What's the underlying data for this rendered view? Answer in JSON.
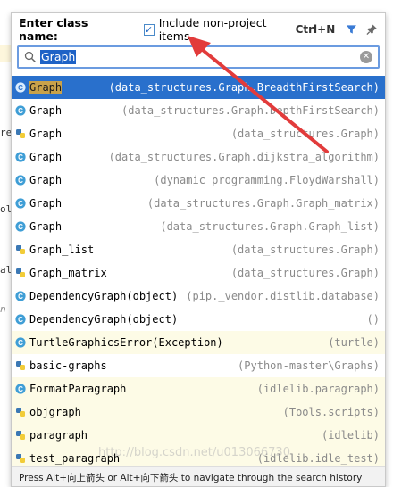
{
  "background_fragments": [
    "re",
    "ol",
    "al",
    "n"
  ],
  "header": {
    "title": "Enter class name:",
    "include_label": "Include non-project items",
    "include_checked": true,
    "shortcut": "Ctrl+N",
    "filter_icon": "funnel-icon",
    "pin_icon": "pin-icon"
  },
  "search": {
    "value": "Graph",
    "search_icon": "magnifier-icon",
    "clear_icon": "clear-icon"
  },
  "results": [
    {
      "prefix": "",
      "hl": "Graph",
      "suffix": "",
      "location": "(data_structures.Graph.BreadthFirstSearch)",
      "icon": "class-icon",
      "selected": true,
      "yellow": false
    },
    {
      "prefix": "Graph",
      "hl": "",
      "suffix": "",
      "location": "(data_structures.Graph.DepthFirstSearch)",
      "icon": "class-icon",
      "selected": false,
      "yellow": false
    },
    {
      "prefix": "Graph",
      "hl": "",
      "suffix": "",
      "location": "(data_structures.Graph)",
      "icon": "python-file-icon",
      "selected": false,
      "yellow": false
    },
    {
      "prefix": "Graph",
      "hl": "",
      "suffix": "",
      "location": "(data_structures.Graph.dijkstra_algorithm)",
      "icon": "class-icon",
      "selected": false,
      "yellow": false
    },
    {
      "prefix": "Graph",
      "hl": "",
      "suffix": "",
      "location": "(dynamic_programming.FloydWarshall)",
      "icon": "class-icon",
      "selected": false,
      "yellow": false
    },
    {
      "prefix": "Graph",
      "hl": "",
      "suffix": "",
      "location": "(data_structures.Graph.Graph_matrix)",
      "icon": "class-icon",
      "selected": false,
      "yellow": false
    },
    {
      "prefix": "Graph",
      "hl": "",
      "suffix": "",
      "location": "(data_structures.Graph.Graph_list)",
      "icon": "class-icon",
      "selected": false,
      "yellow": false
    },
    {
      "prefix": "Graph_list",
      "hl": "",
      "suffix": "",
      "location": "(data_structures.Graph)",
      "icon": "python-file-icon",
      "selected": false,
      "yellow": false
    },
    {
      "prefix": "Graph_matrix",
      "hl": "",
      "suffix": "",
      "location": "(data_structures.Graph)",
      "icon": "python-file-icon",
      "selected": false,
      "yellow": false
    },
    {
      "prefix": "DependencyGraph(object)",
      "hl": "",
      "suffix": "",
      "location": "(pip._vendor.distlib.database)",
      "icon": "class-icon",
      "selected": false,
      "yellow": false
    },
    {
      "prefix": "DependencyGraph(object)",
      "hl": "",
      "suffix": "",
      "location": "()",
      "icon": "class-icon",
      "selected": false,
      "yellow": false
    },
    {
      "prefix": "TurtleGraphicsError(Exception)",
      "hl": "",
      "suffix": "",
      "location": "(turtle)",
      "icon": "class-icon",
      "selected": false,
      "yellow": true
    },
    {
      "prefix": "basic-graphs",
      "hl": "",
      "suffix": "",
      "location": "(Python-master\\Graphs)",
      "icon": "python-file-icon",
      "selected": false,
      "yellow": false
    },
    {
      "prefix": "FormatParagraph",
      "hl": "",
      "suffix": "",
      "location": "(idlelib.paragraph)",
      "icon": "class-icon",
      "selected": false,
      "yellow": true
    },
    {
      "prefix": "objgraph",
      "hl": "",
      "suffix": "",
      "location": "(Tools.scripts)",
      "icon": "python-file-icon",
      "selected": false,
      "yellow": true
    },
    {
      "prefix": "paragraph",
      "hl": "",
      "suffix": "",
      "location": "(idlelib)",
      "icon": "python-file-icon",
      "selected": false,
      "yellow": true
    },
    {
      "prefix": "test_paragraph",
      "hl": "",
      "suffix": "",
      "location": "(idlelib.idle_test)",
      "icon": "python-file-icon",
      "selected": false,
      "yellow": true
    }
  ],
  "footer": {
    "hint": "Press Alt+向上箭头 or Alt+向下箭头 to navigate through the search history"
  },
  "watermark": "http://blog.csdn.net/u013066730",
  "colors": {
    "selection": "#2970cc",
    "highlight": "#c8a24a",
    "arrow": "#e23b3b",
    "class_icon": "#3f9ed6"
  }
}
